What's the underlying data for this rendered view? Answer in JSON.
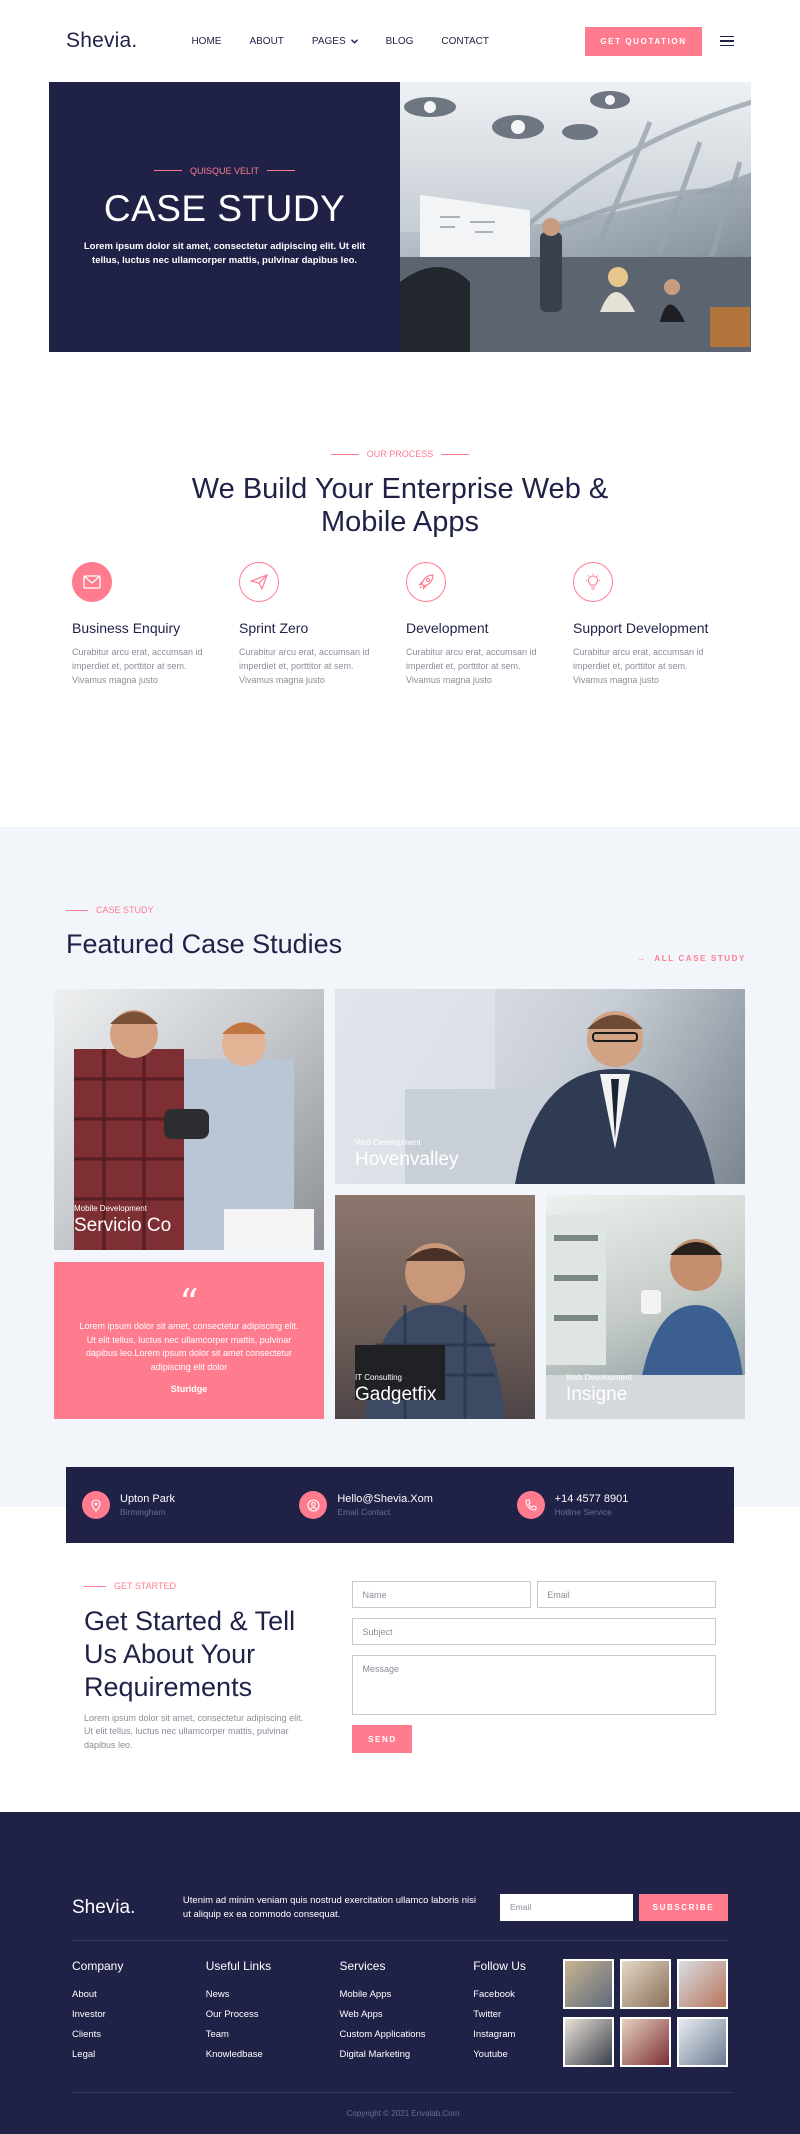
{
  "header": {
    "logo": "Shevia.",
    "nav": [
      "HOME",
      "ABOUT",
      "PAGES",
      "BLOG",
      "CONTACT"
    ],
    "cta": "GET QUOTATION"
  },
  "hero": {
    "eyebrow": "QUISQUE VELIT",
    "title": "CASE STUDY",
    "text": "Lorem ipsum dolor sit amet, consectetur adipiscing elit. Ut elit tellus, luctus nec ullamcorper mattis, pulvinar dapibus leo."
  },
  "process": {
    "eyebrow": "OUR PROCESS",
    "title_line1": "We Build Your Enterprise Web &",
    "title_line2": "Mobile Apps",
    "steps": [
      {
        "title": "Business Enquiry",
        "text": "Curabitur arcu erat, accumsan id imperdiet et, porttitor at sem. Vivamus magna justo",
        "icon": "envelope-icon"
      },
      {
        "title": "Sprint Zero",
        "text": "Curabitur arcu erat, accumsan id imperdiet et, porttitor at sem. Vivamus magna justo",
        "icon": "paper-plane-icon"
      },
      {
        "title": "Development",
        "text": "Curabitur arcu erat, accumsan id imperdiet et, porttitor at sem. Vivamus magna justo",
        "icon": "rocket-icon"
      },
      {
        "title": "Support Development",
        "text": "Curabitur arcu erat, accumsan id imperdiet et, porttitor at sem. Vivamus magna justo",
        "icon": "lightbulb-icon"
      }
    ]
  },
  "cases": {
    "eyebrow": "CASE STUDY",
    "title": "Featured Case Studies",
    "all_link": "ALL CASE STUDY",
    "items": [
      {
        "category": "Mobile Development",
        "name": "Servicio Co"
      },
      {
        "category": "Web Development",
        "name": "Hovenvalley"
      },
      {
        "category": "IT Consulting",
        "name": "Gadgetfix"
      },
      {
        "category": "Web Development",
        "name": "Insigne"
      }
    ],
    "quote": {
      "mark": "“",
      "text": "Lorem ipsum dolor sit amet, consectetur adipiscing elit. Ut elit tellus, luctus nec ullamcorper mattis, pulvinar dapibus leo.Lorem ipsum dolor sit amet consectetur adipiscing elit dolor",
      "author": "Sturidge"
    }
  },
  "contact_strip": [
    {
      "title": "Upton Park",
      "sub": "Birmingham",
      "icon": "location-pin-icon"
    },
    {
      "title": "Hello@Shevia.Xom",
      "sub": "Email Contact",
      "icon": "user-contact-icon"
    },
    {
      "title": "+14 4577 8901",
      "sub": "Hotline Service",
      "icon": "phone-icon"
    }
  ],
  "started": {
    "eyebrow": "GET STARTED",
    "title": "Get Started & Tell Us About Your Requirements",
    "text": "Lorem ipsum dolor sit amet, consectetur adipiscing elit. Ut elit tellus, luctus nec ullamcorper mattis, pulvinar dapibus leo.",
    "form": {
      "name_placeholder": "Name",
      "email_placeholder": "Email",
      "subject_placeholder": "Subject",
      "message_placeholder": "Message",
      "send": "SEND"
    }
  },
  "footer": {
    "logo": "Shevia.",
    "desc": "Utenim ad minim veniam quis nostrud exercitation ullamco laboris nisi ut aliquip ex ea commodo consequat.",
    "email_placeholder": "Email",
    "subscribe": "SUBSCRIBE",
    "columns": [
      {
        "title": "Company",
        "links": [
          "About",
          "Investor",
          "Clients",
          "Legal"
        ]
      },
      {
        "title": "Useful Links",
        "links": [
          "News",
          "Our Process",
          "Team",
          "Knowledbase"
        ]
      },
      {
        "title": "Services",
        "links": [
          "Mobile Apps",
          "Web Apps",
          "Custom Applications",
          "Digital Marketing"
        ]
      },
      {
        "title": "Follow Us",
        "links": [
          "Facebook",
          "Twitter",
          "Instagram",
          "Youtube"
        ]
      }
    ],
    "copyright": "Copyright © 2021 Envalab.Com"
  },
  "colors": {
    "accent": "#ff7c8f",
    "navy": "#1f2147",
    "light_bg": "#f2f6fb"
  }
}
